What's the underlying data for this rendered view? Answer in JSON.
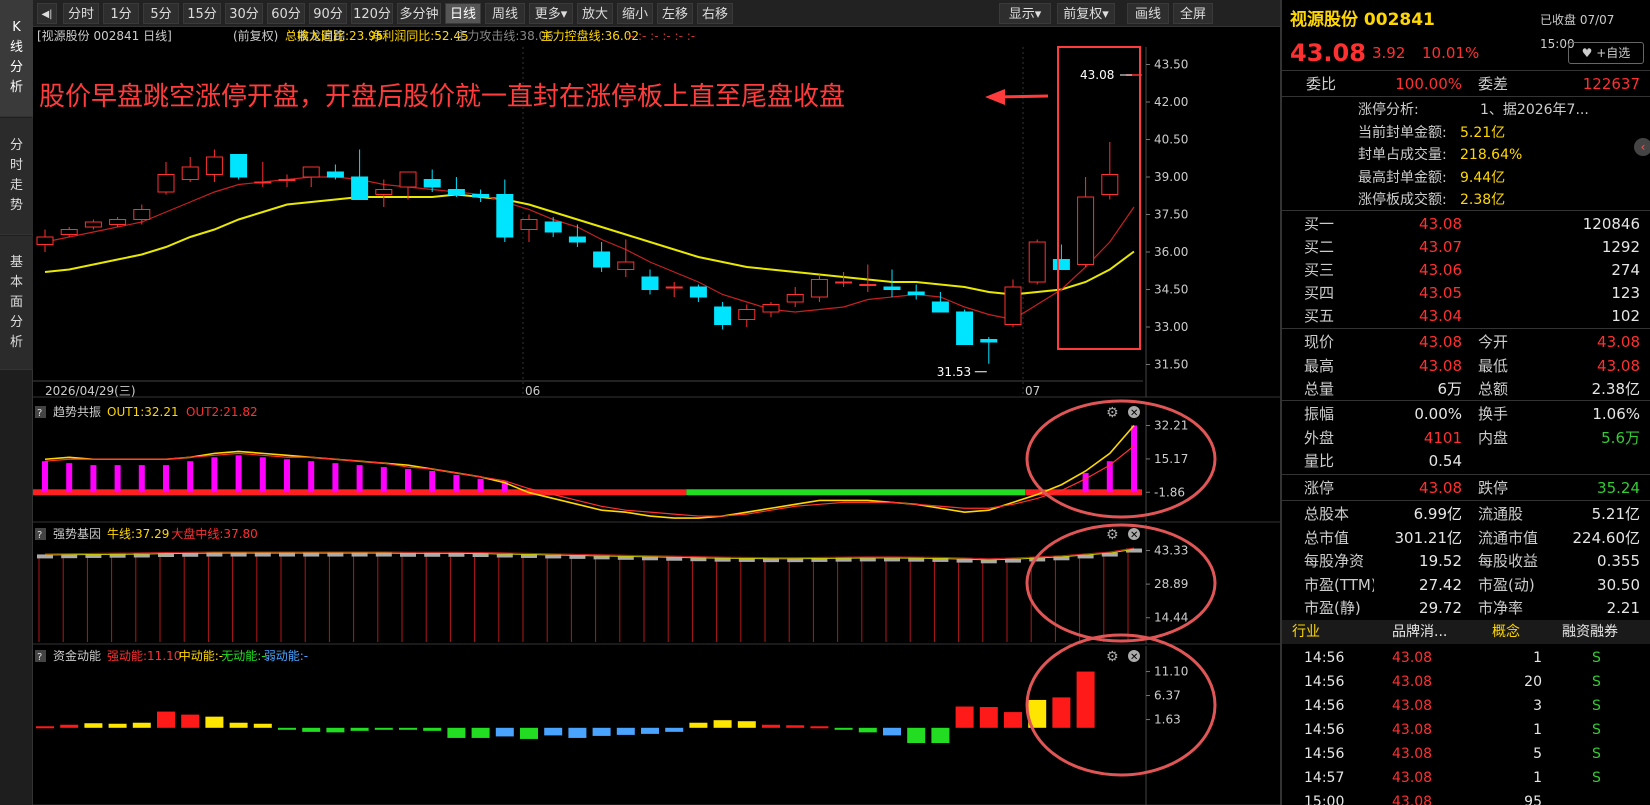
{
  "left_tabs": [
    {
      "label": "K线分析",
      "active": true
    },
    {
      "label": "分时走势",
      "active": false
    },
    {
      "label": "基本面分析",
      "active": false
    }
  ],
  "toolbar": {
    "back_icon": "◀|",
    "periods": [
      "分时",
      "1分",
      "5分",
      "15分",
      "30分",
      "60分",
      "90分",
      "120分",
      "多分钟",
      "日线",
      "周线"
    ],
    "active_period": "日线",
    "more": "更多▾",
    "zoom_in": "放大",
    "zoom_out": "缩小",
    "left": "左移",
    "right": "右移",
    "display": "显示▾",
    "adjust": "前复权▾",
    "draw": "画线",
    "fullscreen": "全屏"
  },
  "chart_header": {
    "title": "[视源股份 002841 日线]",
    "adj": "(前复权)",
    "indicator": "擒龙追踪",
    "items": [
      {
        "text": "总收入同比:23.95",
        "color": "#ffd700"
      },
      {
        "text": "净利润同比:52.45",
        "color": "#ffd700"
      },
      {
        "text": "主力攻击线:38.06",
        "color": "#888888"
      },
      {
        "text": "主力控盘线:36.02",
        "color": "#ffd700"
      },
      {
        "text": ":-  :-  :-  :-  :-  :-",
        "color": "#cc3333"
      }
    ]
  },
  "annotation": "股价早盘跳空涨停开盘，开盘后股价就一直封在涨停板上直至尾盘收盘",
  "price_labels": {
    "high": "43.08",
    "low": "31.53"
  },
  "date_axis": {
    "start": "2026/04/29(三)",
    "m1": "06",
    "m2": "07"
  },
  "chart_data": [
    {
      "type": "candlestick",
      "name": "main",
      "y_ticks": [
        "43.50",
        "42.00",
        "40.50",
        "39.00",
        "37.50",
        "36.00",
        "34.50",
        "33.00",
        "31.50"
      ],
      "ylim": [
        31.0,
        44.2
      ],
      "ohlc": [
        [
          36.3,
          36.9,
          36.0,
          36.6
        ],
        [
          36.7,
          37.0,
          36.6,
          36.9
        ],
        [
          37.0,
          37.3,
          36.9,
          37.2
        ],
        [
          37.1,
          37.4,
          37.0,
          37.3
        ],
        [
          37.3,
          37.9,
          37.1,
          37.7
        ],
        [
          38.4,
          39.6,
          38.3,
          39.1
        ],
        [
          38.9,
          39.8,
          38.8,
          39.4
        ],
        [
          39.1,
          40.1,
          38.8,
          39.8
        ],
        [
          39.9,
          39.9,
          38.9,
          39.0
        ],
        [
          38.8,
          39.6,
          38.6,
          38.8
        ],
        [
          38.9,
          39.1,
          38.6,
          38.9
        ],
        [
          39.0,
          39.4,
          38.6,
          39.4
        ],
        [
          39.2,
          39.5,
          38.9,
          39.0
        ],
        [
          39.0,
          40.1,
          38.9,
          38.1
        ],
        [
          38.3,
          38.9,
          37.8,
          38.5
        ],
        [
          38.6,
          39.2,
          38.1,
          39.2
        ],
        [
          38.9,
          39.3,
          38.4,
          38.6
        ],
        [
          38.5,
          39.0,
          38.2,
          38.3
        ],
        [
          38.3,
          38.5,
          38.0,
          38.2
        ],
        [
          38.3,
          38.9,
          36.4,
          36.6
        ],
        [
          36.9,
          37.5,
          36.4,
          37.3
        ],
        [
          37.2,
          37.4,
          36.6,
          36.8
        ],
        [
          36.6,
          37.1,
          36.2,
          36.4
        ],
        [
          36.0,
          36.4,
          35.2,
          35.4
        ],
        [
          35.3,
          36.5,
          35.0,
          35.6
        ],
        [
          35.0,
          35.3,
          34.3,
          34.5
        ],
        [
          34.6,
          34.8,
          34.2,
          34.6
        ],
        [
          34.6,
          34.7,
          34.0,
          34.2
        ],
        [
          33.8,
          34.0,
          32.9,
          33.1
        ],
        [
          33.3,
          33.9,
          33.0,
          33.7
        ],
        [
          33.6,
          34.0,
          33.4,
          33.9
        ],
        [
          34.0,
          34.6,
          33.8,
          34.3
        ],
        [
          34.2,
          35.1,
          34.0,
          34.9
        ],
        [
          34.8,
          35.2,
          34.6,
          34.8
        ],
        [
          34.7,
          35.5,
          34.4,
          34.7
        ],
        [
          34.6,
          35.3,
          34.2,
          34.5
        ],
        [
          34.4,
          34.7,
          34.1,
          34.3
        ],
        [
          34.0,
          34.4,
          33.6,
          33.6
        ],
        [
          33.6,
          33.7,
          32.3,
          32.3
        ],
        [
          32.5,
          32.6,
          31.53,
          32.4
        ],
        [
          33.1,
          34.9,
          33.0,
          34.6
        ],
        [
          34.8,
          36.5,
          34.7,
          36.4
        ],
        [
          35.7,
          36.3,
          35.5,
          35.3
        ],
        [
          35.5,
          39.0,
          35.4,
          38.2
        ],
        [
          38.3,
          40.4,
          38.1,
          39.1
        ],
        [
          43.08,
          43.08,
          43.08,
          43.08
        ]
      ],
      "ma5": [
        36.4,
        36.6,
        36.8,
        37.0,
        37.2,
        37.6,
        38.0,
        38.4,
        38.7,
        38.8,
        38.9,
        39.0,
        39.0,
        38.9,
        38.7,
        38.6,
        38.5,
        38.4,
        38.3,
        38.0,
        37.7,
        37.3,
        37.0,
        36.5,
        36.1,
        35.6,
        35.2,
        34.8,
        34.3,
        34.0,
        33.7,
        33.6,
        33.7,
        33.8,
        34.1,
        34.2,
        34.3,
        34.2,
        33.8,
        33.5,
        33.3,
        33.9,
        34.5,
        35.4,
        36.4,
        37.8
      ],
      "control": [
        35.2,
        35.3,
        35.5,
        35.7,
        35.9,
        36.2,
        36.6,
        36.9,
        37.3,
        37.6,
        37.9,
        38.0,
        38.1,
        38.2,
        38.2,
        38.2,
        38.2,
        38.3,
        38.2,
        38.1,
        37.9,
        37.6,
        37.3,
        37.0,
        36.7,
        36.4,
        36.1,
        35.8,
        35.6,
        35.4,
        35.3,
        35.2,
        35.1,
        35.0,
        34.9,
        34.8,
        34.8,
        34.7,
        34.6,
        34.4,
        34.3,
        34.4,
        34.5,
        34.8,
        35.3,
        36.02
      ]
    },
    {
      "type": "bar",
      "name": "趋势共振",
      "legend": [
        {
          "text": "OUT1:32.21",
          "color": "#ffd700"
        },
        {
          "text": "OUT2:21.82",
          "color": "#ff3030"
        }
      ],
      "y_ticks": [
        "32.21",
        "15.17",
        "-1.86"
      ],
      "ylim": [
        -16,
        34
      ],
      "values": [
        14,
        13,
        12,
        12,
        12,
        12,
        14,
        16,
        17,
        16,
        15,
        14,
        13,
        12,
        11,
        10,
        9,
        7,
        5,
        4,
        0,
        0,
        0,
        0,
        0,
        0,
        0,
        0,
        0,
        0,
        0,
        0,
        0,
        0,
        0,
        0,
        0,
        0,
        0,
        0,
        0,
        0,
        0,
        8,
        14,
        32.21
      ],
      "out1": [
        15,
        16,
        15,
        15,
        15,
        15,
        16,
        18,
        19,
        18,
        17,
        16,
        15,
        14,
        13,
        12,
        10,
        8,
        6,
        3,
        -2,
        -5,
        -8,
        -11,
        -12,
        -14,
        -15,
        -15,
        -14,
        -12,
        -10,
        -8,
        -6,
        -6,
        -6,
        -7,
        -8,
        -10,
        -12,
        -11,
        -7,
        -3,
        2,
        9,
        18,
        32.21
      ],
      "out2": [
        14,
        15,
        15,
        15,
        15,
        15,
        16,
        17,
        18,
        17,
        16,
        16,
        15,
        14,
        13,
        11,
        10,
        8,
        6,
        4,
        0,
        -3,
        -6,
        -9,
        -11,
        -12,
        -13,
        -14,
        -14,
        -13,
        -11,
        -9,
        -8,
        -7,
        -7,
        -7,
        -8,
        -9,
        -10,
        -10,
        -8,
        -5,
        -1,
        5,
        12,
        21.82
      ],
      "base_colors": {
        "pos": "#ff2020",
        "neg": "#22dd22"
      }
    },
    {
      "type": "bar",
      "name": "强势基因",
      "legend": [
        {
          "text": "牛线:37.29",
          "color": "#ffd700"
        },
        {
          "text": "大盘中线:37.80",
          "color": "#ff3030"
        }
      ],
      "y_ticks": [
        "43.33",
        "28.89",
        "14.44"
      ],
      "ylim": [
        4,
        47
      ],
      "values": [
        40.8,
        40.9,
        41.0,
        41.1,
        41.2,
        41.4,
        41.5,
        41.6,
        41.6,
        41.6,
        41.6,
        41.6,
        41.6,
        41.6,
        41.6,
        41.5,
        41.5,
        41.5,
        41.4,
        41.2,
        41.0,
        40.8,
        40.6,
        40.4,
        40.2,
        40.0,
        39.8,
        39.6,
        39.4,
        39.3,
        39.2,
        39.2,
        39.3,
        39.4,
        39.5,
        39.5,
        39.4,
        39.3,
        39.0,
        38.7,
        39.0,
        39.5,
        40.0,
        40.8,
        41.6,
        43.33
      ]
    },
    {
      "type": "bar",
      "name": "资金动能",
      "legend": [
        {
          "text": "强动能:11.10",
          "color": "#ff3030"
        },
        {
          "text": "中动能:-",
          "color": "#ffd700"
        },
        {
          "text": "无动能:-",
          "color": "#22dd22"
        },
        {
          "text": "弱动能:-",
          "color": "#4aa3ff"
        }
      ],
      "y_ticks": [
        "11.10",
        "6.37",
        "1.63"
      ],
      "ylim": [
        -3,
        12
      ],
      "values": [
        0.3,
        0.6,
        0.9,
        0.8,
        1.0,
        3.2,
        2.6,
        2.2,
        1.0,
        0.8,
        -0.3,
        -0.8,
        -0.9,
        -0.6,
        -0.2,
        -0.2,
        -0.6,
        -2.0,
        -2.0,
        -1.7,
        -2.2,
        -1.5,
        -2.0,
        -1.6,
        -1.4,
        -1.2,
        -0.8,
        1.0,
        1.5,
        1.3,
        0.6,
        0.5,
        0.3,
        -0.3,
        -0.9,
        -1.5,
        -3.0,
        -3.0,
        4.2,
        4.1,
        3.1,
        5.5,
        6.0,
        11.1
      ]
    }
  ],
  "quote": {
    "name": "视源股份 002841",
    "status": "已收盘 07/07 15:00",
    "price": "43.08",
    "change": "3.92",
    "pct": "10.01%",
    "watch": "♥ +自选",
    "wb_label": "委比",
    "wb": "100.00%",
    "wc_label": "委差",
    "wc": "122637",
    "limit_info": [
      [
        "涨停分析:",
        "1、据2026年7..."
      ],
      [
        "当前封单金额:",
        "5.21亿"
      ],
      [
        "封单占成交量:",
        "218.64%"
      ],
      [
        "最高封单金额:",
        "9.44亿"
      ],
      [
        "涨停板成交额:",
        "2.38亿"
      ]
    ],
    "bids": [
      [
        "买一",
        "43.08",
        "120846"
      ],
      [
        "买二",
        "43.07",
        "1292"
      ],
      [
        "买三",
        "43.06",
        "274"
      ],
      [
        "买四",
        "43.05",
        "123"
      ],
      [
        "买五",
        "43.04",
        "102"
      ]
    ],
    "stats": [
      [
        "现价",
        "43.08",
        "red",
        "今开",
        "43.08",
        "red"
      ],
      [
        "最高",
        "43.08",
        "red",
        "最低",
        "43.08",
        "red"
      ],
      [
        "总量",
        "6万",
        "white",
        "总额",
        "2.38亿",
        "white"
      ]
    ],
    "stats2": [
      [
        "振幅",
        "0.00%",
        "white",
        "换手",
        "1.06%",
        "white"
      ],
      [
        "外盘",
        "4101",
        "red",
        "内盘",
        "5.6万",
        "green"
      ],
      [
        "量比",
        "0.54",
        "white",
        "",
        "",
        " "
      ]
    ],
    "limits": [
      [
        "涨停",
        "43.08",
        "red",
        "跌停",
        "35.24",
        "green"
      ]
    ],
    "fund": [
      [
        "总股本",
        "6.99亿",
        "流通股",
        "5.21亿"
      ],
      [
        "总市值",
        "301.21亿",
        "流通市值",
        "224.60亿"
      ],
      [
        "每股净资",
        "19.52",
        "每股收益",
        "0.355"
      ],
      [
        "市盈(TTM)",
        "27.42",
        "市盈(动)",
        "30.50"
      ],
      [
        "市盈(静)",
        "29.72",
        "市净率",
        "2.21"
      ]
    ],
    "tags": [
      "行业",
      "品牌消...",
      "概念",
      "融资融券"
    ],
    "ticks": [
      [
        "14:56",
        "43.08",
        "1",
        "S"
      ],
      [
        "14:56",
        "43.08",
        "20",
        "S"
      ],
      [
        "14:56",
        "43.08",
        "3",
        "S"
      ],
      [
        "14:56",
        "43.08",
        "1",
        "S"
      ],
      [
        "14:56",
        "43.08",
        "5",
        "S"
      ],
      [
        "14:57",
        "43.08",
        "1",
        "S"
      ],
      [
        "15:00",
        "43.08",
        "95",
        ""
      ]
    ]
  },
  "colors": {
    "up": "#ff3030",
    "down": "#00e5ff",
    "ma5": "#c82020",
    "control": "#e8e800",
    "gray": "#9a9a9a",
    "circle": "#e05555"
  }
}
